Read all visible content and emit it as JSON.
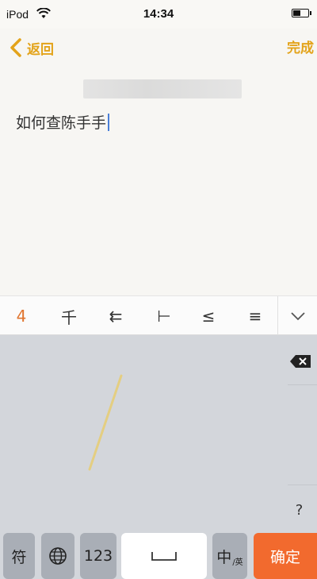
{
  "status_bar": {
    "carrier": "iPod",
    "time": "14:34"
  },
  "nav": {
    "back_label": "返回",
    "done_label": "完成"
  },
  "note": {
    "text": "如何查陈手手"
  },
  "candidates": {
    "items": [
      "4",
      "千",
      "⇇",
      "⊢",
      "≤",
      "≡"
    ],
    "accent_color": "#e0742e"
  },
  "keyboard": {
    "question_label": "?",
    "symbol_key": "符",
    "numbers_key": "123",
    "lang_key_main": "中",
    "lang_key_sub": "/英",
    "confirm_key": "确定",
    "confirm_color": "#f26a2e"
  },
  "colors": {
    "nav_accent": "#e3a31a",
    "keyboard_bg": "#d3d6db",
    "caret": "#4a7fd8"
  },
  "icons": [
    "wifi-icon",
    "battery-icon",
    "chevron-left-icon",
    "chevron-down-icon",
    "backspace-icon",
    "globe-icon",
    "space-icon"
  ]
}
